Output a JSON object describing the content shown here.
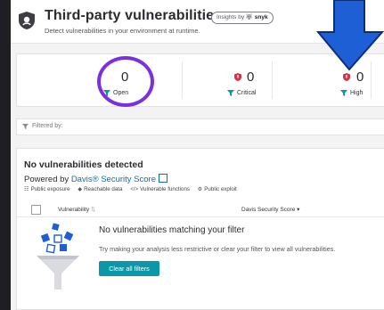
{
  "header": {
    "title": "Third-party vulnerabilities",
    "insights_prefix": "Insights by",
    "insights_brand": "snyk",
    "subtitle": "Detect vulnerabilities in your environment at runtime."
  },
  "stats": [
    {
      "value": "0",
      "label": "Open"
    },
    {
      "value": "0",
      "label": "Critical"
    },
    {
      "value": "0",
      "label": "High"
    }
  ],
  "filter": {
    "label": "Filtered by:"
  },
  "results": {
    "heading": "No vulnerabilities detected",
    "powered_prefix": "Powered by",
    "powered_link": "Davis® Security Score",
    "legend": [
      "Public exposure",
      "Reachable data",
      "Vulnerable functions",
      "Public exploit"
    ],
    "columns": {
      "vulnerability": "Vulnerability",
      "score": "Davis Security Score ▾"
    },
    "empty_title": "No vulnerabilities matching your filter",
    "empty_desc": "Try making your analysis less restrictive or clear your filter to view all vulnerabilities.",
    "clear_button": "Clear all filters"
  },
  "colors": {
    "accent": "#0a98a8",
    "link": "#0f6fa8",
    "critical": "#d6334a",
    "highlight_circle": "#7b2fe0",
    "arrow": "#1f5fd6"
  }
}
